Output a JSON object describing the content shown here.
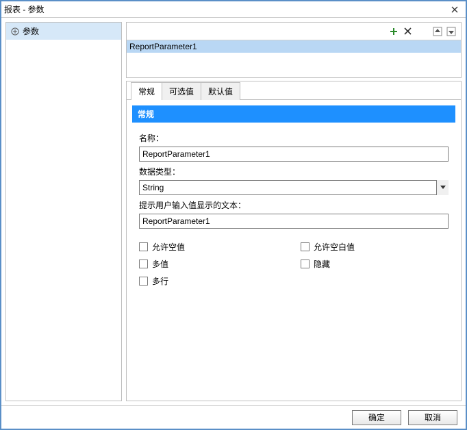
{
  "window": {
    "title": "报表 - 参数"
  },
  "tree": {
    "root_label": "参数"
  },
  "param_list": {
    "items": [
      {
        "name": "ReportParameter1"
      }
    ]
  },
  "tabs": {
    "general": "常规",
    "available": "可选值",
    "default": "默认值"
  },
  "section": {
    "title": "常规"
  },
  "form": {
    "name_label": "名称：",
    "name_value": "ReportParameter1",
    "datatype_label": "数据类型：",
    "datatype_value": "String",
    "prompt_label": "提示用户输入值显示的文本：",
    "prompt_value": "ReportParameter1"
  },
  "checkboxes": {
    "allow_null": "允许空值",
    "allow_blank": "允许空白值",
    "multivalue": "多值",
    "hidden": "隐藏",
    "multiline": "多行"
  },
  "buttons": {
    "ok": "确定",
    "cancel": "取消"
  }
}
